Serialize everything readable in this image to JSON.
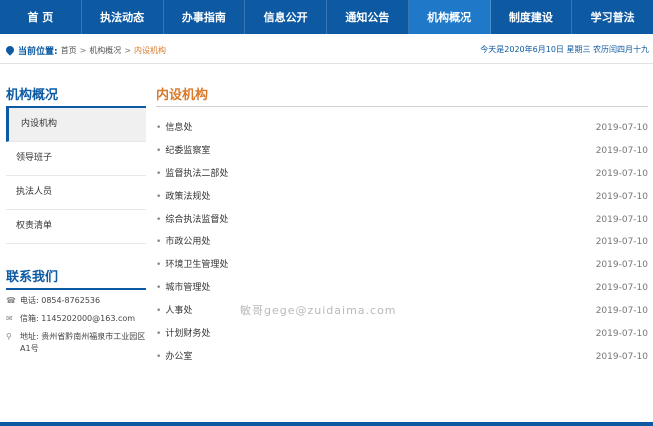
{
  "nav": [
    {
      "label": "首 页"
    },
    {
      "label": "执法动态"
    },
    {
      "label": "办事指南"
    },
    {
      "label": "信息公开"
    },
    {
      "label": "通知公告"
    },
    {
      "label": "机构概况"
    },
    {
      "label": "制度建设"
    },
    {
      "label": "学习普法"
    }
  ],
  "nav_active_index": 5,
  "breadcrumb": {
    "label": "当前位置:",
    "items": [
      "首页",
      "机构概况",
      "内设机构"
    ],
    "separator": ">"
  },
  "date_text": "今天是2020年6月10日 星期三 农历闰四月十九",
  "sidebar": {
    "title": "机构概况",
    "items": [
      {
        "label": "内设机构"
      },
      {
        "label": "领导班子"
      },
      {
        "label": "执法人员"
      },
      {
        "label": "权责清单"
      }
    ]
  },
  "contact": {
    "title": "联系我们",
    "phone": "电话: 0854-8762536",
    "email": "信箱: 1145202000@163.com",
    "address": "地址: 贵州省黔南州福泉市工业园区A1号"
  },
  "main": {
    "title": "内设机构",
    "rows": [
      {
        "label": "信息处",
        "date": "2019-07-10"
      },
      {
        "label": "纪委监察室",
        "date": "2019-07-10"
      },
      {
        "label": "监督执法二部处",
        "date": "2019-07-10"
      },
      {
        "label": "政策法规处",
        "date": "2019-07-10"
      },
      {
        "label": "综合执法监督处",
        "date": "2019-07-10"
      },
      {
        "label": "市政公用处",
        "date": "2019-07-10"
      },
      {
        "label": "环境卫生管理处",
        "date": "2019-07-10"
      },
      {
        "label": "城市管理处",
        "date": "2019-07-10"
      },
      {
        "label": "人事处",
        "date": "2019-07-10"
      },
      {
        "label": "计划财务处",
        "date": "2019-07-10"
      },
      {
        "label": "办公室",
        "date": "2019-07-10"
      }
    ]
  },
  "watermark": "敏哥gege@zuidaima.com",
  "colors": {
    "nav_bg": "#0d5aa3",
    "accent": "#d97a2a",
    "active_tab": "#1f78c8"
  }
}
